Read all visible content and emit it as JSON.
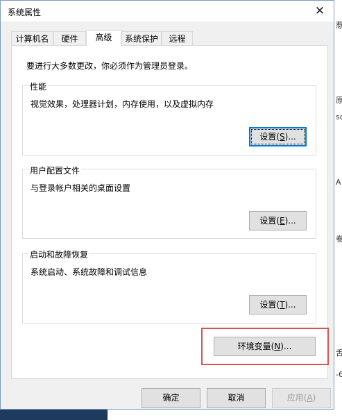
{
  "window": {
    "title": "系统属性"
  },
  "tabs": [
    {
      "label": "计算机名"
    },
    {
      "label": "硬件"
    },
    {
      "label": "高级"
    },
    {
      "label": "系统保护"
    },
    {
      "label": "远程"
    }
  ],
  "active_tab": "高级",
  "notice": "要进行大多数更改，你必须作为管理员登录。",
  "performance": {
    "title": "性能",
    "desc": "视觉效果，处理器计划，内存使用，以及虚拟内存",
    "button_pre": "设置(",
    "button_key": "S",
    "button_post": ")..."
  },
  "user_profiles": {
    "title": "用户配置文件",
    "desc": "与登录帐户相关的桌面设置",
    "button_pre": "设置(",
    "button_key": "E",
    "button_post": ")..."
  },
  "startup_recovery": {
    "title": "启动和故障恢复",
    "desc": "系统启动、系统故障和调试信息",
    "button_pre": "设置(",
    "button_key": "T",
    "button_post": ")..."
  },
  "env_vars": {
    "button_pre": "环境变量(",
    "button_key": "N",
    "button_post": ")..."
  },
  "footer": {
    "ok": "确定",
    "cancel": "取消",
    "apply_pre": "应用(",
    "apply_key": "A",
    "apply_post": ")"
  },
  "background": {
    "fragments": [
      "惹",
      "原",
      "sc",
      "A",
      "卷",
      "舌",
      "-6"
    ]
  },
  "colors": {
    "highlight_box": "#d9534f",
    "focus_border": "#0078d7",
    "dialog_bg": "#f0f0f0"
  }
}
